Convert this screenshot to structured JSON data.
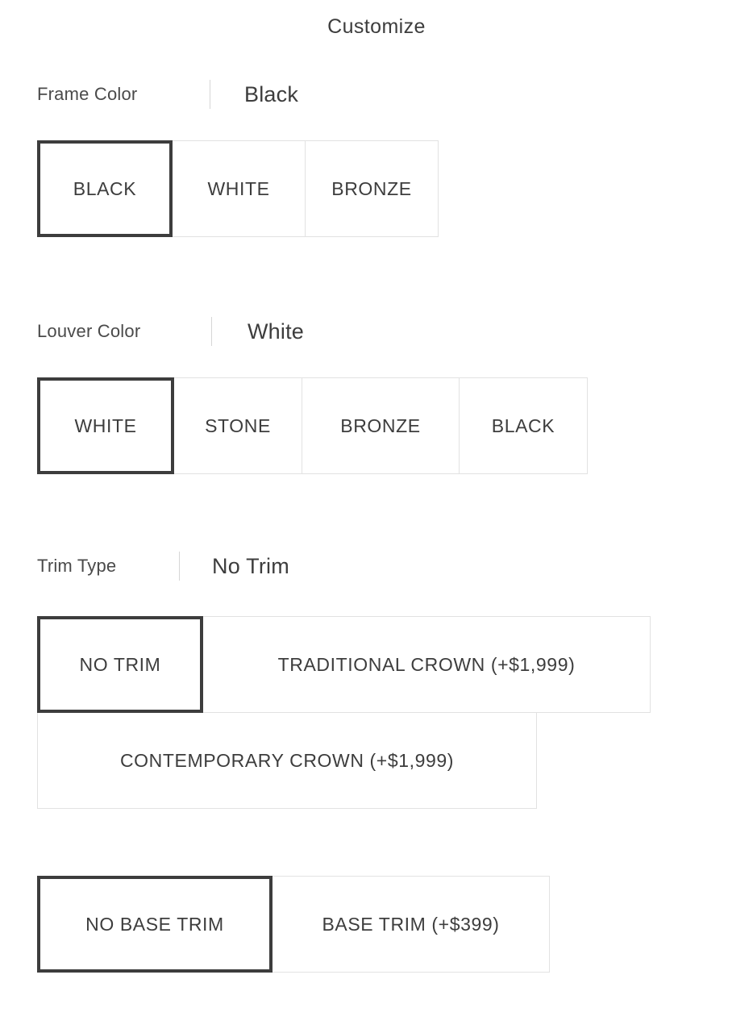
{
  "header": {
    "title": "Customize"
  },
  "groups": [
    {
      "id": "frame-color",
      "label": "Frame Color",
      "value": "Black",
      "options": [
        {
          "label": "BLACK",
          "selected": true
        },
        {
          "label": "WHITE",
          "selected": false
        },
        {
          "label": "BRONZE",
          "selected": false
        }
      ]
    },
    {
      "id": "louver-color",
      "label": "Louver Color",
      "value": "White",
      "options": [
        {
          "label": "WHITE",
          "selected": true
        },
        {
          "label": "STONE",
          "selected": false
        },
        {
          "label": "BRONZE",
          "selected": false
        },
        {
          "label": "BLACK",
          "selected": false
        }
      ]
    },
    {
      "id": "trim-type",
      "label": "Trim Type",
      "value": "No Trim",
      "options": [
        {
          "label": "NO TRIM",
          "selected": true
        },
        {
          "label": "TRADITIONAL CROWN (+$1,999)",
          "selected": false
        },
        {
          "label": "CONTEMPORARY CROWN (+$1,999)",
          "selected": false
        }
      ]
    },
    {
      "id": "base-trim",
      "label": "",
      "value": "",
      "options": [
        {
          "label": "NO BASE TRIM",
          "selected": true
        },
        {
          "label": "BASE TRIM (+$399)",
          "selected": false
        }
      ]
    }
  ],
  "colors": {
    "text": "#3d3d3d",
    "selected_border": "#3d3d3d",
    "unselected_border": "#e2e2e2",
    "divider": "#d6d6d6",
    "background": "#ffffff"
  }
}
